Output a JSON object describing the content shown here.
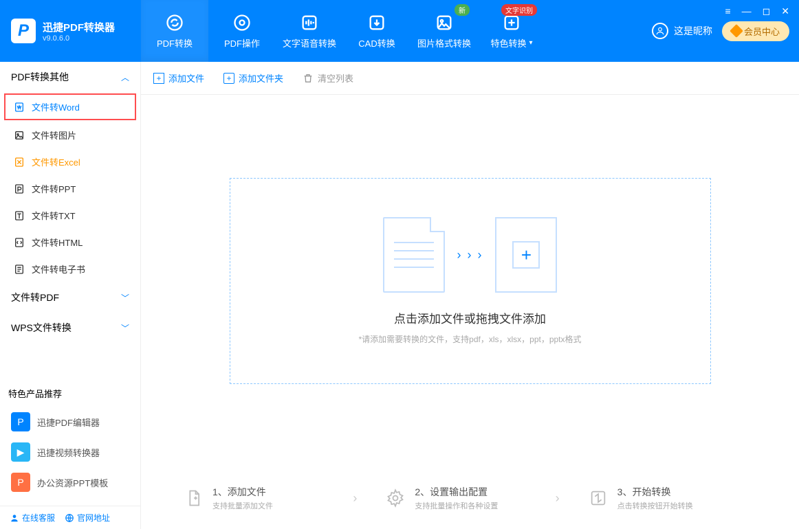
{
  "app": {
    "name": "迅捷PDF转换器",
    "version": "v9.0.6.0"
  },
  "nav": {
    "tabs": [
      {
        "label": "PDF转换"
      },
      {
        "label": "PDF操作"
      },
      {
        "label": "文字语音转换"
      },
      {
        "label": "CAD转换"
      },
      {
        "label": "图片格式转换",
        "badge": "新"
      },
      {
        "label": "特色转换",
        "badge": "文字识别"
      }
    ]
  },
  "user": {
    "nickname": "这是昵称",
    "vip_btn": "会员中心"
  },
  "sidebar": {
    "groups": [
      {
        "title": "PDF转换其他",
        "expanded": true,
        "items": [
          {
            "label": "文件转Word"
          },
          {
            "label": "文件转图片"
          },
          {
            "label": "文件转Excel"
          },
          {
            "label": "文件转PPT"
          },
          {
            "label": "文件转TXT"
          },
          {
            "label": "文件转HTML"
          },
          {
            "label": "文件转电子书"
          }
        ]
      },
      {
        "title": "文件转PDF",
        "expanded": false
      },
      {
        "title": "WPS文件转换",
        "expanded": false
      }
    ],
    "promo_title": "特色产品推荐",
    "promo": [
      {
        "label": "迅捷PDF编辑器"
      },
      {
        "label": "迅捷视频转换器"
      },
      {
        "label": "办公资源PPT模板"
      }
    ],
    "bottom": {
      "chat": "在线客服",
      "site": "官网地址"
    }
  },
  "toolbar": {
    "add_file": "添加文件",
    "add_folder": "添加文件夹",
    "clear": "清空列表"
  },
  "dropzone": {
    "title": "点击添加文件或拖拽文件添加",
    "subtitle": "*请添加需要转换的文件，支持pdf，xls，xlsx，ppt，pptx格式"
  },
  "steps": [
    {
      "title": "1、添加文件",
      "sub": "支持批量添加文件"
    },
    {
      "title": "2、设置输出配置",
      "sub": "支持批量操作和各种设置"
    },
    {
      "title": "3、开始转换",
      "sub": "点击转换按钮开始转换"
    }
  ]
}
